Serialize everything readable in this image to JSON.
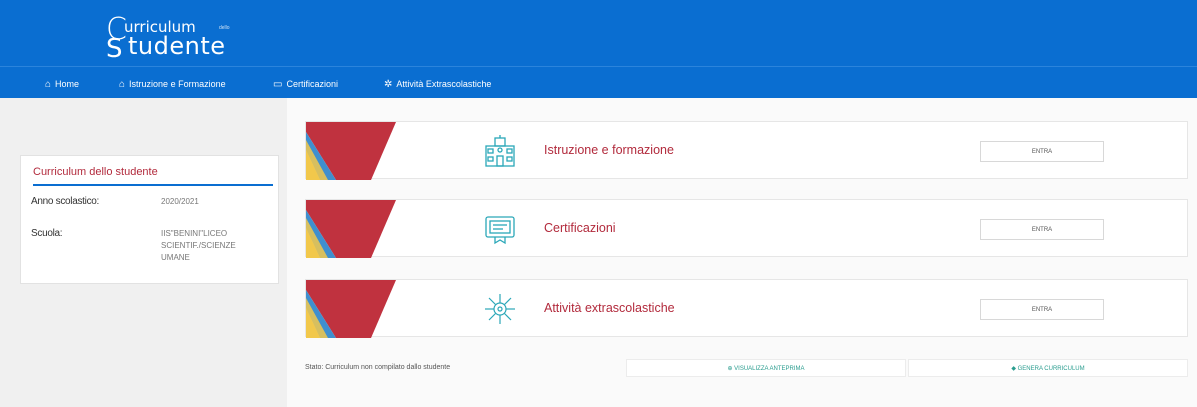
{
  "header": {
    "logo": {
      "line1": "urriculum",
      "tiny": "dello",
      "line2": "tudente",
      "c_glyph": "C",
      "s_glyph": "S"
    }
  },
  "nav": {
    "items": [
      {
        "label": "Home",
        "icon": "home-icon",
        "glyph": "⌂"
      },
      {
        "label": "Istruzione e Formazione",
        "icon": "school-icon",
        "glyph": "⌂"
      },
      {
        "label": "Certificazioni",
        "icon": "certificate-icon",
        "glyph": "▭"
      },
      {
        "label": "Attività Extrascolastiche",
        "icon": "activity-icon",
        "glyph": "✲"
      }
    ]
  },
  "sidebar": {
    "title": "Curriculum dello studente",
    "anno_label": "Anno scolastico:",
    "anno_value": "2020/2021",
    "scuola_label": "Scuola:",
    "scuola_value": "IIS\"BENINI\"LICEO SCIENTIF./SCIENZE UMANE"
  },
  "sections": [
    {
      "label": "Istruzione e formazione",
      "button": "ENTRA",
      "icon": "school-building-icon"
    },
    {
      "label": "Certificazioni",
      "button": "ENTRA",
      "icon": "certificate-icon"
    },
    {
      "label": "Attività extrascolastiche",
      "button": "ENTRA",
      "icon": "activity-network-icon"
    }
  ],
  "footer": {
    "status": "Stato: Curriculum non compilato dallo studente",
    "preview_button": "⊕ VISUALIZZA ANTEPRIMA",
    "generate_button": "◆ GENERA CURRICULUM"
  },
  "colors": {
    "header_blue": "#0a6ed1",
    "accent_red": "#b22a3c",
    "teal": "#2a9d8f"
  }
}
